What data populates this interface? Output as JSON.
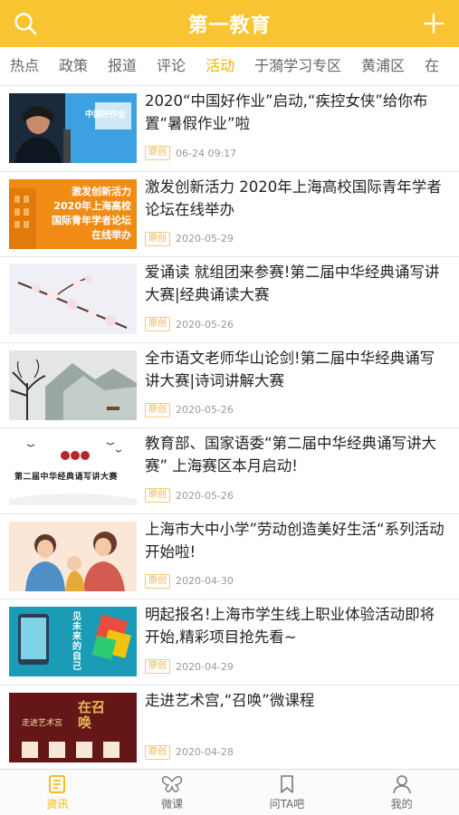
{
  "header": {
    "title": "第一教育",
    "search_icon": "search-icon",
    "add_icon": "plus-icon",
    "brand_color": "#f9c431"
  },
  "tabs": [
    {
      "label": "热点",
      "active": false
    },
    {
      "label": "政策",
      "active": false
    },
    {
      "label": "报道",
      "active": false
    },
    {
      "label": "评论",
      "active": false
    },
    {
      "label": "活动",
      "active": true
    },
    {
      "label": "于漪学习专区",
      "active": false
    },
    {
      "label": "黄浦区",
      "active": false
    },
    {
      "label": "在",
      "active": false
    }
  ],
  "articles": [
    {
      "title": "2020“中国好作业”启动,“疾控女侠”给你布置“暑假作业”啦",
      "badge": "原创",
      "date": "06-24 09:17",
      "thumb_text": "",
      "thumb_logo": "中国好作业"
    },
    {
      "title": "激发创新活力 2020年上海高校国际青年学者论坛在线举办",
      "badge": "原创",
      "date": "2020-05-29",
      "thumb_lines": [
        "激发创新活力",
        "2020年上海高校",
        "国际青年学者论坛",
        "在线举办"
      ]
    },
    {
      "title": "爱诵读 就组团来参赛!第二届中华经典诵写讲大赛|经典诵读大赛",
      "badge": "原创",
      "date": "2020-05-26"
    },
    {
      "title": "全市语文老师华山论剑!第二届中华经典诵写讲大赛|诗词讲解大赛",
      "badge": "原创",
      "date": "2020-05-26"
    },
    {
      "title": "教育部、国家语委“第二届中华经典诵写讲大赛” 上海赛区本月启动!",
      "badge": "原创",
      "date": "2020-05-26",
      "thumb_text": "第二届中华经典诵写讲大赛"
    },
    {
      "title": "上海市大中小学”劳动创造美好生活“系列活动开始啦!",
      "badge": "原创",
      "date": "2020-04-30"
    },
    {
      "title": "明起报名!上海市学生线上职业体验活动即将开始,精彩项目抢先看~",
      "badge": "原创",
      "date": "2020-04-29",
      "thumb_text": "见未来的自己"
    },
    {
      "title": "走进艺术宫,“召唤”微课程",
      "badge": "原创",
      "date": "2020-04-28",
      "thumb_text": "走进艺术宫",
      "thumb_big": "在召唤"
    }
  ],
  "bottom_nav": [
    {
      "label": "资讯",
      "icon": "news-icon",
      "active": true
    },
    {
      "label": "微课",
      "icon": "butterfly-icon",
      "active": false
    },
    {
      "label": "问TA吧",
      "icon": "bookmark-icon",
      "active": false
    },
    {
      "label": "我的",
      "icon": "user-icon",
      "active": false
    }
  ]
}
